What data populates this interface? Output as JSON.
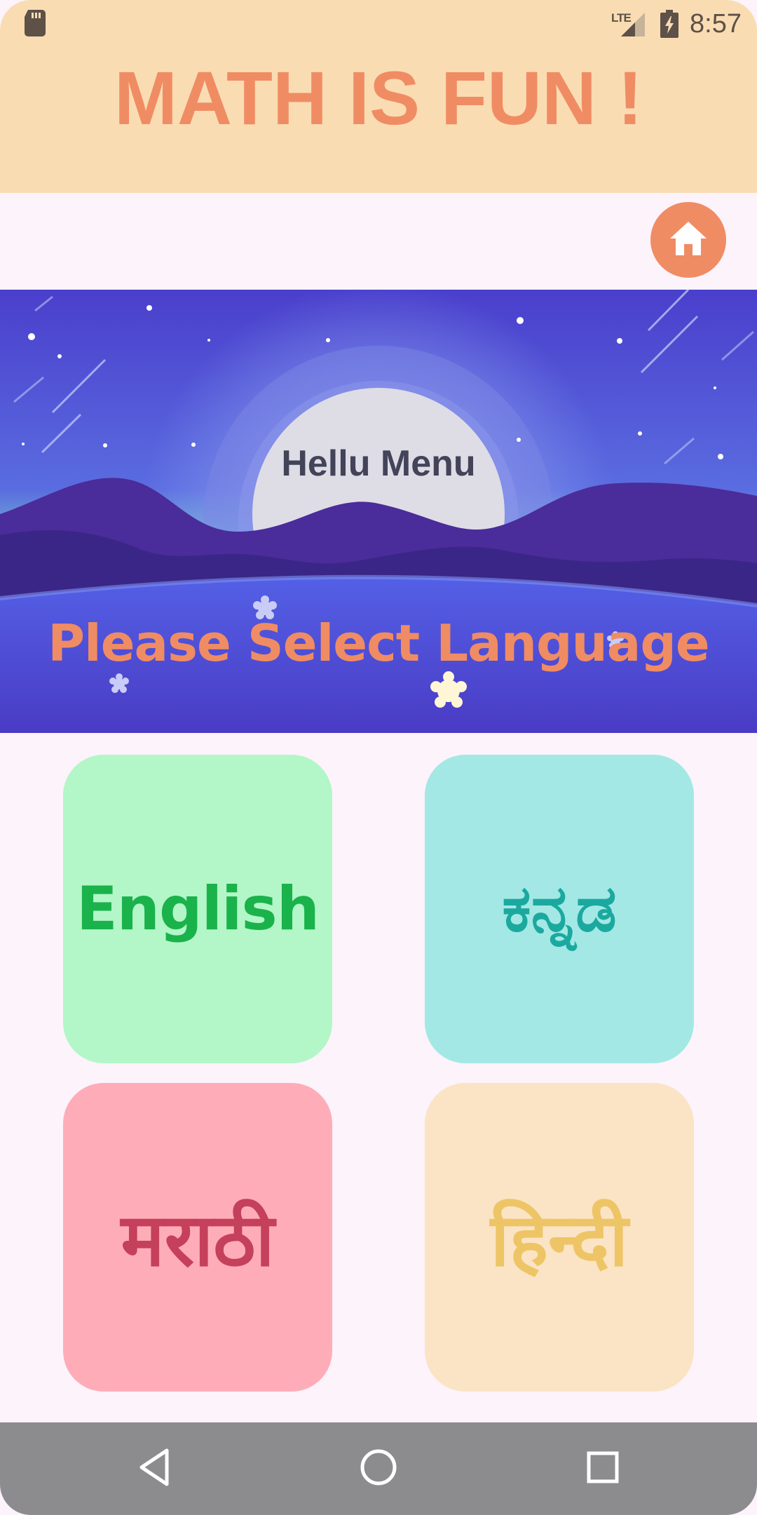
{
  "status_bar": {
    "time": "8:57",
    "network": "LTE",
    "icons": [
      "sd-card-icon",
      "lte-signal-icon",
      "battery-charging-icon"
    ]
  },
  "header": {
    "title": "MATH IS FUN !"
  },
  "home_button": {
    "icon": "home-icon"
  },
  "banner": {
    "greeting": "Hellu Menu",
    "prompt": "Please Select Language"
  },
  "languages": [
    {
      "label": "English",
      "color": "#1ab24b",
      "background": "#b3f6c8"
    },
    {
      "label": "ಕನ್ನಡ",
      "color": "#1ba99f",
      "background": "#a3e8e5"
    },
    {
      "label": "मराठी",
      "color": "#c5405b",
      "background": "#feadb8"
    },
    {
      "label": "हिन्दी",
      "color": "#eec566",
      "background": "#fbe4c5"
    }
  ],
  "nav_bar": {
    "icons": [
      "back-icon",
      "home-circle-icon",
      "recents-icon"
    ]
  },
  "colors": {
    "accent": "#f08c63",
    "header_background": "#fadcb3",
    "page_background": "#fcf3fb"
  }
}
